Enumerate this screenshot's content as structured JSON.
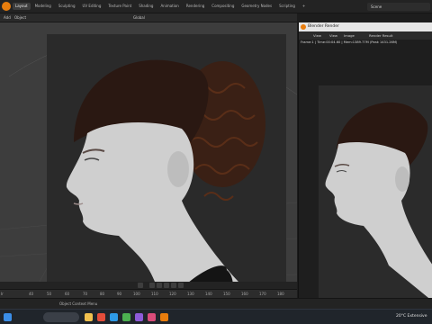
{
  "menu": {
    "tabs": [
      "Layout",
      "Modeling",
      "Sculpting",
      "UV Editing",
      "Texture Paint",
      "Shading",
      "Animation",
      "Rendering",
      "Compositing",
      "Geometry Nodes",
      "Scripting"
    ],
    "active_tab": "Layout",
    "add_tab": "+",
    "scene": "Scene"
  },
  "viewport_header": {
    "mode": "Add",
    "object": "Object",
    "transform": "Global"
  },
  "render_window": {
    "title": "Blender Render",
    "view_label": "View",
    "view_menu": "View",
    "image_menu": "Image",
    "result_name": "Render Result",
    "meta": "Frame:1 | Time:00:04.60 | Mem:1389.77M (Peak 1431.26M)"
  },
  "timeline": {
    "start_label": "Ir",
    "ticks": [
      "40",
      "50",
      "60",
      "70",
      "80",
      "90",
      "100",
      "110",
      "120",
      "130",
      "140",
      "150",
      "160",
      "170",
      "180",
      "190"
    ],
    "current_frame": "1"
  },
  "status": {
    "message": "Object Context Menu"
  },
  "taskbar": {
    "weather": "20°C  Extensive"
  },
  "colors": {
    "accent": "#e87d0d",
    "selection": "#4772b3"
  }
}
